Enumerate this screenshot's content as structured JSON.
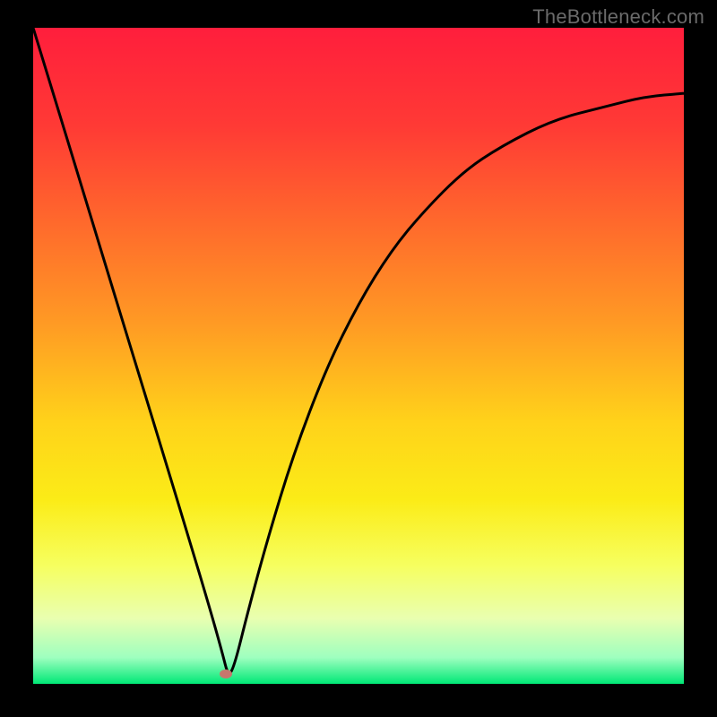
{
  "watermark": {
    "text": "TheBottleneck.com"
  },
  "gradient": {
    "stops": [
      {
        "pct": 0,
        "color": "#ff1e3c"
      },
      {
        "pct": 15,
        "color": "#ff3a35"
      },
      {
        "pct": 30,
        "color": "#ff6a2c"
      },
      {
        "pct": 45,
        "color": "#ff9a24"
      },
      {
        "pct": 60,
        "color": "#ffd21a"
      },
      {
        "pct": 72,
        "color": "#fbec17"
      },
      {
        "pct": 82,
        "color": "#f6ff60"
      },
      {
        "pct": 90,
        "color": "#e9ffb0"
      },
      {
        "pct": 96,
        "color": "#9effbf"
      },
      {
        "pct": 100,
        "color": "#00e876"
      }
    ]
  },
  "marker": {
    "x_pct": 0.296,
    "y_pct": 0.985,
    "color": "#c7776d"
  },
  "curve_stroke": "#000000",
  "chart_data": {
    "type": "line",
    "title": "",
    "xlabel": "",
    "ylabel": "",
    "xlim": [
      0,
      1
    ],
    "ylim": [
      0,
      1
    ],
    "series": [
      {
        "name": "bottleneck-curve",
        "x": [
          0.0,
          0.04,
          0.08,
          0.12,
          0.16,
          0.2,
          0.24,
          0.27,
          0.29,
          0.3,
          0.31,
          0.33,
          0.36,
          0.4,
          0.45,
          0.5,
          0.55,
          0.6,
          0.66,
          0.72,
          0.8,
          0.88,
          0.94,
          1.0
        ],
        "y": [
          1.0,
          0.87,
          0.74,
          0.61,
          0.48,
          0.35,
          0.22,
          0.12,
          0.05,
          0.01,
          0.03,
          0.11,
          0.22,
          0.35,
          0.48,
          0.58,
          0.66,
          0.72,
          0.78,
          0.82,
          0.86,
          0.88,
          0.895,
          0.9
        ]
      }
    ],
    "marker": {
      "x": 0.296,
      "y": 0.015
    }
  }
}
